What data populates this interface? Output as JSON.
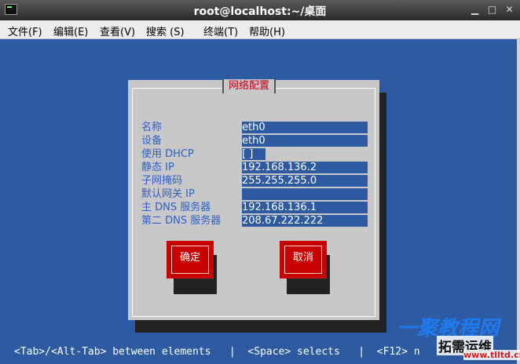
{
  "window": {
    "title": "root@localhost:~/桌面"
  },
  "menu": [
    "文件(F)",
    "编辑(E)",
    "查看(V)",
    "搜索 (S)",
    "终端(T)",
    "帮助(H)"
  ],
  "dialog": {
    "title": "网络配置",
    "fields": [
      {
        "label": "名称",
        "value": "eth0"
      },
      {
        "label": "设备",
        "value": "eth0"
      },
      {
        "label": "使用 DHCP",
        "value": "[ ]"
      },
      {
        "label": "静态 IP",
        "value": "192.168.136.2"
      },
      {
        "label": "子网掩码",
        "value": "255.255.255.0"
      },
      {
        "label": "默认网关 IP",
        "value": ""
      },
      {
        "label": "主 DNS 服务器",
        "value": "192.168.136.1"
      },
      {
        "label": "第二 DNS 服务器",
        "value": "208.67.222.222"
      }
    ],
    "ok_label": "确定",
    "cancel_label": "取消"
  },
  "statusline": "<Tab>/<Alt-Tab> between elements   |  <Space> selects   |  <F12> n",
  "watermark": {
    "top": "一聚教程网",
    "bottom": "拓需运维",
    "url": "www.tlltd.cn"
  },
  "colors": {
    "terminal_bg": "#2d5aa0",
    "dialog_bg": "#c8c8c8",
    "button_red": "#c80000",
    "label_blue": "#2c5fc8"
  }
}
